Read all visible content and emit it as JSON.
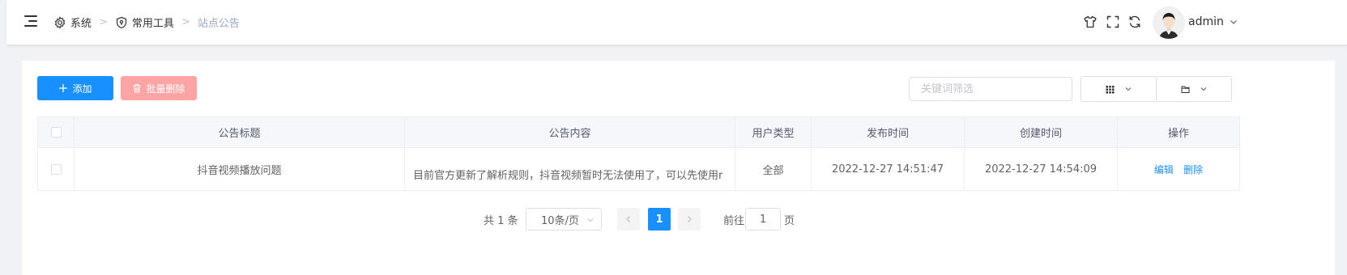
{
  "breadcrumb": {
    "items": [
      {
        "label": "系统",
        "icon": "gear-icon"
      },
      {
        "label": "常用工具",
        "icon": "shield-icon"
      },
      {
        "label": "站点公告"
      }
    ],
    "separator": ">"
  },
  "header": {
    "icons": [
      "shirt-icon",
      "fullscreen-icon",
      "refresh-icon"
    ],
    "user": "admin"
  },
  "toolbar": {
    "add_label": "添加",
    "batch_delete_label": "批量删除",
    "search_placeholder": "关键词筛选",
    "search_value": ""
  },
  "table": {
    "columns": [
      "公告标题",
      "公告内容",
      "用户类型",
      "发布时间",
      "创建时间",
      "操作"
    ],
    "rows": [
      {
        "title": "抖音视频播放问题",
        "content": "目前官方更新了解析规则，抖音视频暂时无法使用了，可以先使用r",
        "user_type": "全部",
        "publish_time": "2022-12-27 14:51:47",
        "create_time": "2022-12-27 14:54:09",
        "edit_label": "编辑",
        "delete_label": "删除"
      }
    ]
  },
  "pagination": {
    "total_text": "共 1 条",
    "page_size": "10条/页",
    "current_page": "1",
    "goto_prefix": "前往",
    "goto_value": "1",
    "goto_suffix": "页"
  },
  "colors": {
    "primary": "#1890ff",
    "danger_disabled": "#ffa4a4"
  }
}
